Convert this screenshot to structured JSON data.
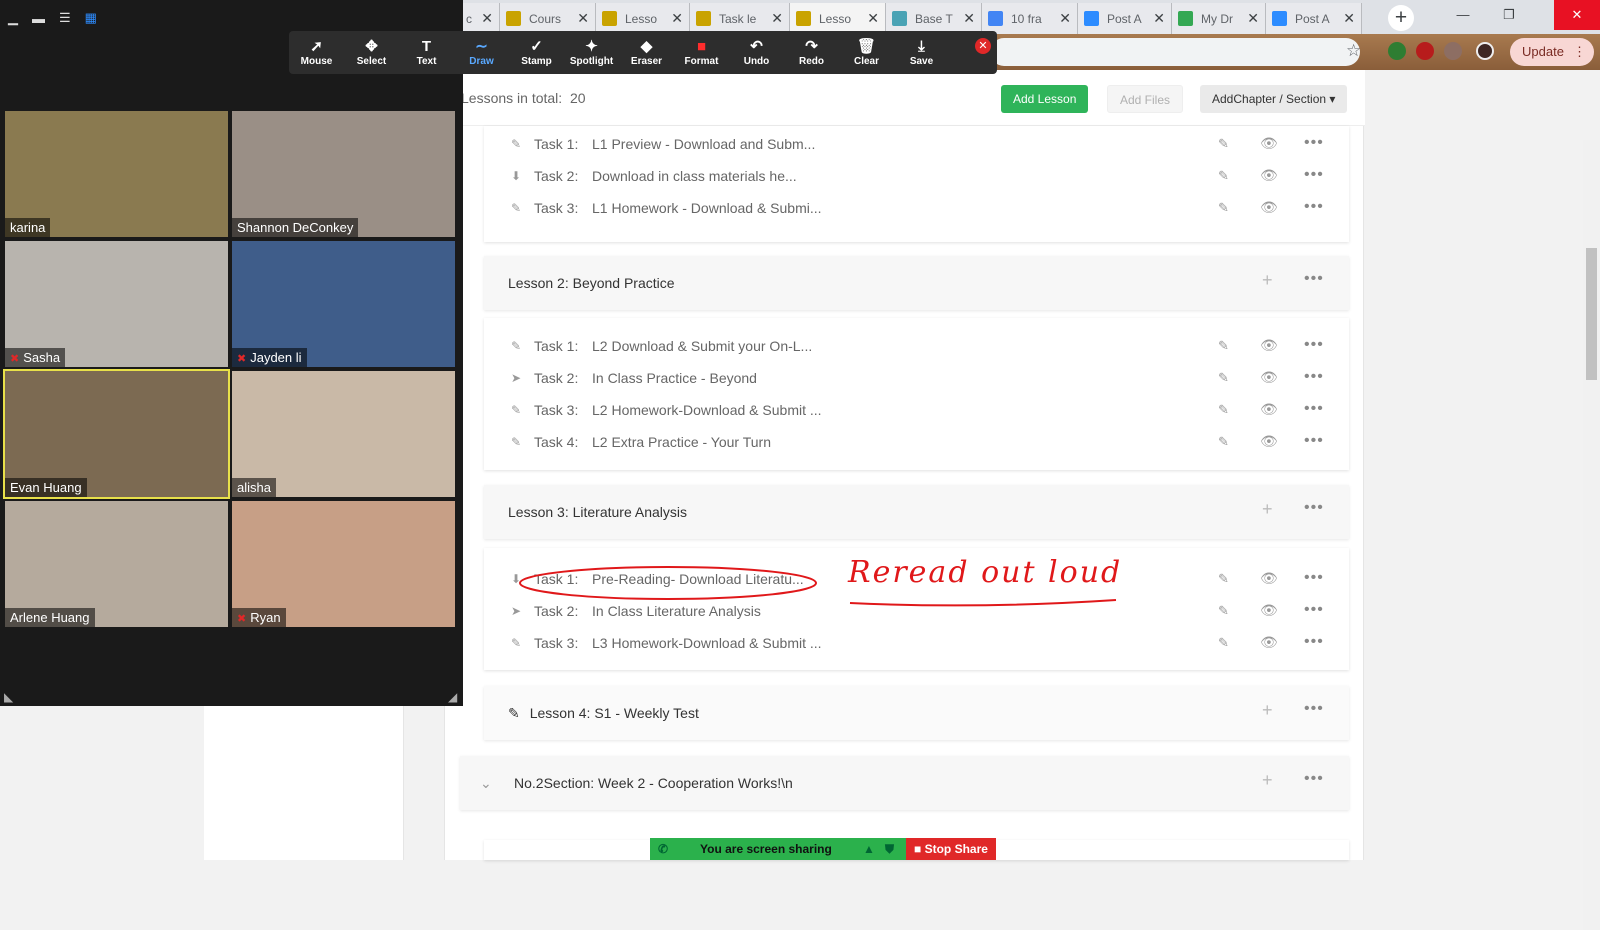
{
  "browser": {
    "tabs": [
      {
        "label": "c",
        "icon": "doc-icon",
        "color": "#4285f4",
        "active": false
      },
      {
        "label": "Cours",
        "icon": "lms-icon",
        "color": "#c9a300",
        "active": false
      },
      {
        "label": "Lesso",
        "icon": "lms-icon",
        "color": "#c9a300",
        "active": false
      },
      {
        "label": "Task le",
        "icon": "lms-icon",
        "color": "#c9a300",
        "active": false
      },
      {
        "label": "Lesso",
        "icon": "lms-icon",
        "color": "#c9a300",
        "active": true
      },
      {
        "label": "Base T",
        "icon": "cat-icon",
        "color": "#4aa3b5",
        "active": false
      },
      {
        "label": "10 fra",
        "icon": "docs-icon",
        "color": "#4285f4",
        "active": false
      },
      {
        "label": "Post A",
        "icon": "zoom-icon",
        "color": "#2d8cff",
        "active": false
      },
      {
        "label": "My Dr",
        "icon": "drive-icon",
        "color": "#34a853",
        "active": false
      },
      {
        "label": "Post A",
        "icon": "zoom-icon",
        "color": "#2d8cff",
        "active": false
      }
    ],
    "new_tab": "+",
    "update_label": "Update",
    "update_menu": "⋮",
    "star": "☆",
    "window": {
      "minimize": "—",
      "restore": "❐",
      "close": "✕"
    }
  },
  "lessons_header": {
    "total_label": "Lessons in total:",
    "total_value": "20",
    "add_lesson": "Add Lesson",
    "add_files": "Add Files",
    "add_chapter": "AddChapter / Section ▾"
  },
  "lesson1_tasks": [
    {
      "num": "Task 1:",
      "name": "L1 Preview - Download and Subm...",
      "icon": "✎"
    },
    {
      "num": "Task 2:",
      "name": "Download in class materials he...",
      "icon": "⬇"
    },
    {
      "num": "Task 3:",
      "name": "L1 Homework - Download & Submi...",
      "icon": "✎"
    }
  ],
  "lesson2": {
    "title": "Lesson 2:   Beyond Practice"
  },
  "lesson2_tasks": [
    {
      "num": "Task 1:",
      "name": "L2 Download & Submit your On-L...",
      "icon": "✎"
    },
    {
      "num": "Task 2:",
      "name": "In Class Practice - Beyond",
      "icon": "➤"
    },
    {
      "num": "Task 3:",
      "name": "L2 Homework-Download & Submit ...",
      "icon": "✎"
    },
    {
      "num": "Task 4:",
      "name": "L2 Extra Practice - Your Turn",
      "icon": "✎"
    }
  ],
  "lesson3": {
    "title": "Lesson 3:   Literature Analysis"
  },
  "lesson3_tasks": [
    {
      "num": "Task 1:",
      "name": "Pre-Reading- Download Literatu...",
      "icon": "⬇"
    },
    {
      "num": "Task 2:",
      "name": "In Class Literature Analysis",
      "icon": "➤"
    },
    {
      "num": "Task 3:",
      "name": "L3 Homework-Download & Submit ...",
      "icon": "✎"
    }
  ],
  "lesson4": {
    "title": "Lesson 4:   S1 - Weekly Test"
  },
  "section2": {
    "title": "No.2Section:  Week 2 - Cooperation Works!\\n"
  },
  "row_actions": {
    "edit": "✎",
    "view": "👁",
    "more": "•••",
    "plus": "+"
  },
  "annotation": {
    "text": "Reread out loud",
    "color": "#e0181a"
  },
  "zoom": {
    "participants": [
      {
        "name": "karina",
        "muted": false,
        "bg": "#8a7a50"
      },
      {
        "name": "Shannon DeConkey",
        "muted": false,
        "bg": "#9a8f86"
      },
      {
        "name": "Sasha",
        "muted": true,
        "bg": "#b8b4ae"
      },
      {
        "name": "Jayden li",
        "muted": true,
        "bg": "#3f5d8a"
      },
      {
        "name": "Evan Huang",
        "muted": false,
        "bg": "#7c6a52"
      },
      {
        "name": "alisha",
        "muted": false,
        "bg": "#c9b9a7"
      },
      {
        "name": "Arlene Huang",
        "muted": false,
        "bg": "#b5aa9d"
      },
      {
        "name": "Ryan",
        "muted": true,
        "bg": "#c79f86"
      }
    ],
    "mute_icon": "✖",
    "tools": [
      {
        "label": "Mouse",
        "icon": "➚"
      },
      {
        "label": "Select",
        "icon": "✥"
      },
      {
        "label": "Text",
        "icon": "T"
      },
      {
        "label": "Draw",
        "icon": "∼"
      },
      {
        "label": "Stamp",
        "icon": "✓"
      },
      {
        "label": "Spotlight",
        "icon": "✦"
      },
      {
        "label": "Eraser",
        "icon": "◆"
      },
      {
        "label": "Format",
        "icon": "■"
      },
      {
        "label": "Undo",
        "icon": "↶"
      },
      {
        "label": "Redo",
        "icon": "↷"
      },
      {
        "label": "Clear",
        "icon": "🗑"
      },
      {
        "label": "Save",
        "icon": "⤓"
      }
    ],
    "active_tool": "Draw",
    "sharing_label": "You are screen sharing",
    "stop_share": "Stop Share"
  }
}
